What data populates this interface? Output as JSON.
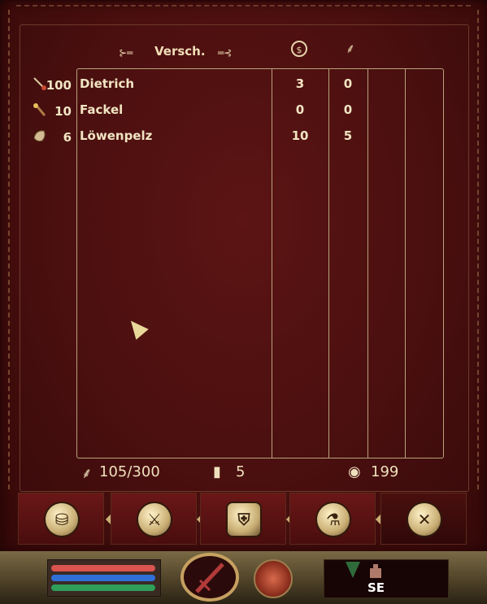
{
  "header": {
    "title": "Versch.",
    "col_icon_1": "gold-coin-icon",
    "col_icon_2": "feather-weight-icon"
  },
  "left_stats": [
    {
      "icon": "lockpick-icon",
      "count": "100"
    },
    {
      "icon": "torch-icon",
      "count": "10"
    },
    {
      "icon": "pelt-icon",
      "count": "6"
    }
  ],
  "items": [
    {
      "name": "Dietrich",
      "value": "3",
      "weight": "0"
    },
    {
      "name": "Fackel",
      "value": "0",
      "weight": "0"
    },
    {
      "name": "Löwenpelz",
      "value": "10",
      "weight": "5"
    }
  ],
  "footer": {
    "encumbrance": "105/300",
    "armor": "5",
    "gold": "199"
  },
  "tabs": [
    {
      "icon": "sack-icon"
    },
    {
      "icon": "axe-icon"
    },
    {
      "icon": "shield-icon"
    },
    {
      "icon": "potion-icon"
    },
    {
      "icon": "crossed-tools-icon"
    }
  ],
  "hud": {
    "compass": "SE",
    "health_color": "#d9534f",
    "magicka_color": "#2f6fd6",
    "fatigue_color": "#2e9e58"
  }
}
